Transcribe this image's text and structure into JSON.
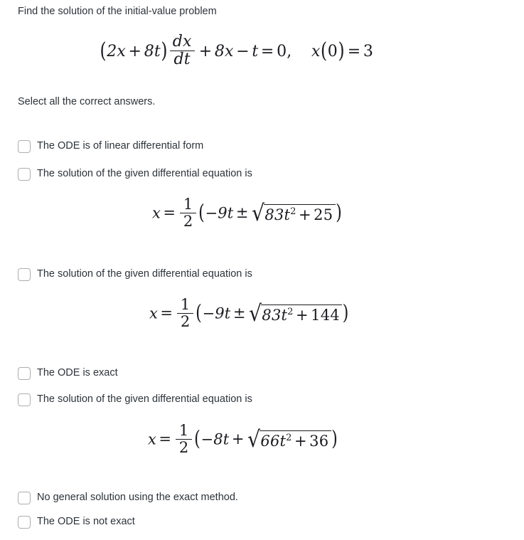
{
  "prompt": {
    "text": "Find the solution of the initial-value problem"
  },
  "instruction": {
    "text": "Select all the correct answers."
  },
  "equation_main": {
    "latex": "(2x + 8t) dx/dt + 8x - t = 0,  x(0) = 3",
    "lhs_open": "(",
    "lhs_coef_x": "2x",
    "lhs_plus": "+",
    "lhs_coef_t": "8t",
    "lhs_close": ")",
    "frac_num": "dx",
    "frac_den": "dt",
    "term_plus": "+",
    "term_8x": "8x",
    "term_minus": "−",
    "term_t": "t",
    "equals": "=",
    "zero": "0",
    "comma": ",",
    "ic_x": "x",
    "ic_open": "(",
    "ic_zero": "0",
    "ic_close": ")",
    "ic_equals": "=",
    "ic_value": "3"
  },
  "formulas": [
    {
      "id": "formula-1",
      "latex": "x = 1/2 (-9t +/- sqrt(83t^2 + 25))",
      "lhs": "x",
      "equals": "=",
      "frac_num": "1",
      "frac_den": "2",
      "open": "(",
      "minus": "−",
      "first_term": "9t",
      "sign": "±",
      "radical": "√",
      "radicand_coef": "83t",
      "radicand_exp": "2",
      "radicand_plus": "+",
      "radicand_const": "25",
      "close": ")"
    },
    {
      "id": "formula-2",
      "latex": "x = 1/2 (-9t +/- sqrt(83t^2 + 144))",
      "lhs": "x",
      "equals": "=",
      "frac_num": "1",
      "frac_den": "2",
      "open": "(",
      "minus": "−",
      "first_term": "9t",
      "sign": "±",
      "radical": "√",
      "radicand_coef": "83t",
      "radicand_exp": "2",
      "radicand_plus": "+",
      "radicand_const": "144",
      "close": ")"
    },
    {
      "id": "formula-3",
      "latex": "x = 1/2 (-8t + sqrt(66t^2 + 36))",
      "lhs": "x",
      "equals": "=",
      "frac_num": "1",
      "frac_den": "2",
      "open": "(",
      "minus": "−",
      "first_term": "8t",
      "sign": "+",
      "radical": "√",
      "radicand_coef": "66t",
      "radicand_exp": "2",
      "radicand_plus": "+",
      "radicand_const": "36",
      "close": ")"
    }
  ],
  "options": [
    {
      "label": "The ODE is of linear differential form",
      "checked": false
    },
    {
      "label": "The solution of the given differential equation is",
      "checked": false
    },
    {
      "label": "The solution of the given differential equation is",
      "checked": false
    },
    {
      "label": "The ODE is exact",
      "checked": false
    },
    {
      "label": "The solution of the given differential equation is",
      "checked": false
    },
    {
      "label": "No general solution using the exact method.",
      "checked": false
    },
    {
      "label": "The ODE is not exact",
      "checked": false
    }
  ],
  "colors": {
    "background": "#ffffff",
    "text": "#2d3339",
    "math_text": "#1b1b20",
    "checkbox_border": "#adadad"
  }
}
